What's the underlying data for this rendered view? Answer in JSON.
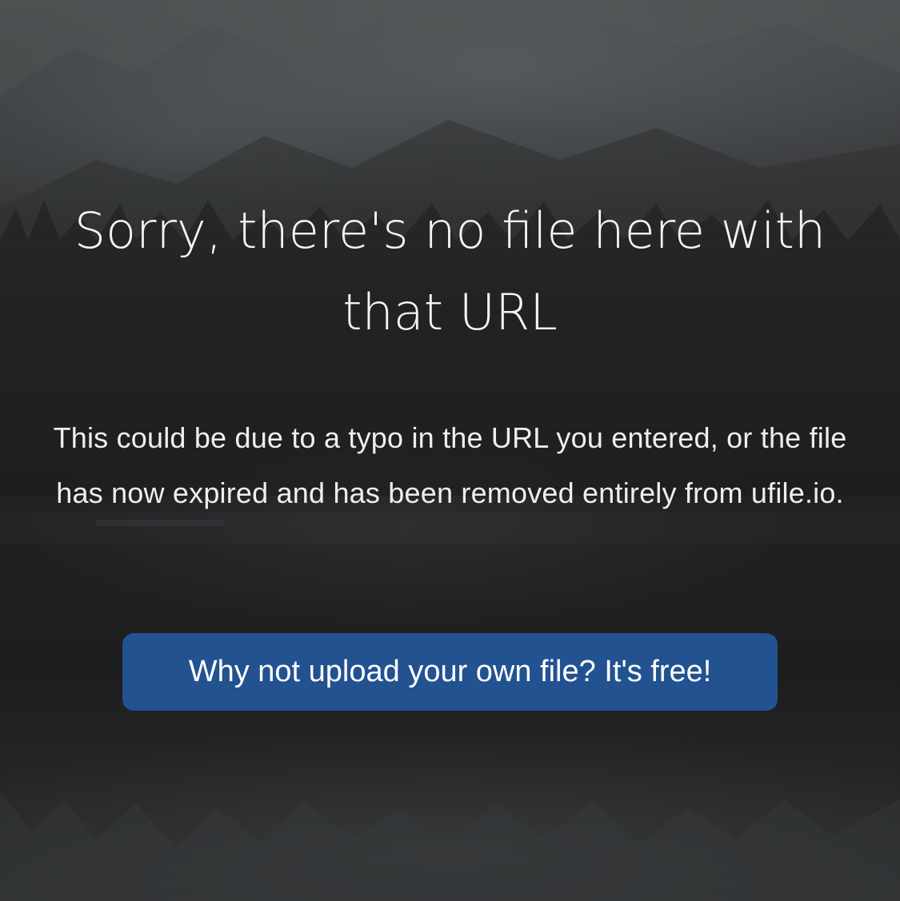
{
  "error_page": {
    "headline": "Sorry, there's no file here with that URL",
    "message": "This could be due to a typo in the URL you entered, or the file has now expired and has been removed entirely from ufile.io.",
    "cta_label": "Why not upload your own file? It's free!"
  },
  "colors": {
    "button_background": "#225290",
    "text": "#ffffff",
    "background": "#232425"
  }
}
